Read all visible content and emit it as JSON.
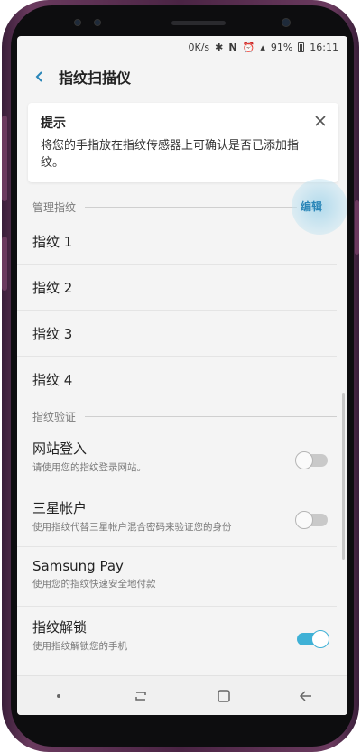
{
  "status_bar": {
    "net_speed": "0K/s",
    "battery": "91%",
    "time": "16:11"
  },
  "app_bar": {
    "title": "指纹扫描仪"
  },
  "tip": {
    "title": "提示",
    "body": "将您的手指放在指纹传感器上可确认是否已添加指纹。"
  },
  "manage": {
    "header": "管理指纹",
    "edit_label": "编辑",
    "fingerprints": [
      "指纹 1",
      "指纹 2",
      "指纹 3",
      "指纹 4"
    ]
  },
  "verify": {
    "header": "指纹验证",
    "settings": [
      {
        "title": "网站登入",
        "subtitle": "请使用您的指纹登录网站。",
        "toggle": "off"
      },
      {
        "title": "三星帐户",
        "subtitle": "使用指纹代替三星帐户混合密码来验证您的身份",
        "toggle": "off"
      },
      {
        "title": "Samsung Pay",
        "subtitle": "使用您的指纹快速安全地付款",
        "toggle": "none"
      },
      {
        "title": "指纹解锁",
        "subtitle": "使用指纹解锁您的手机",
        "toggle": "on"
      }
    ]
  },
  "colors": {
    "accent": "#2a86b8",
    "toggle_on": "#3fb1d6",
    "phone_body": "#4a2444"
  },
  "icons": {
    "back": "chevron-left-icon",
    "close": "close-icon",
    "nav": [
      "dot-icon",
      "recent-apps-icon",
      "home-icon",
      "back-arrow-icon"
    ]
  }
}
